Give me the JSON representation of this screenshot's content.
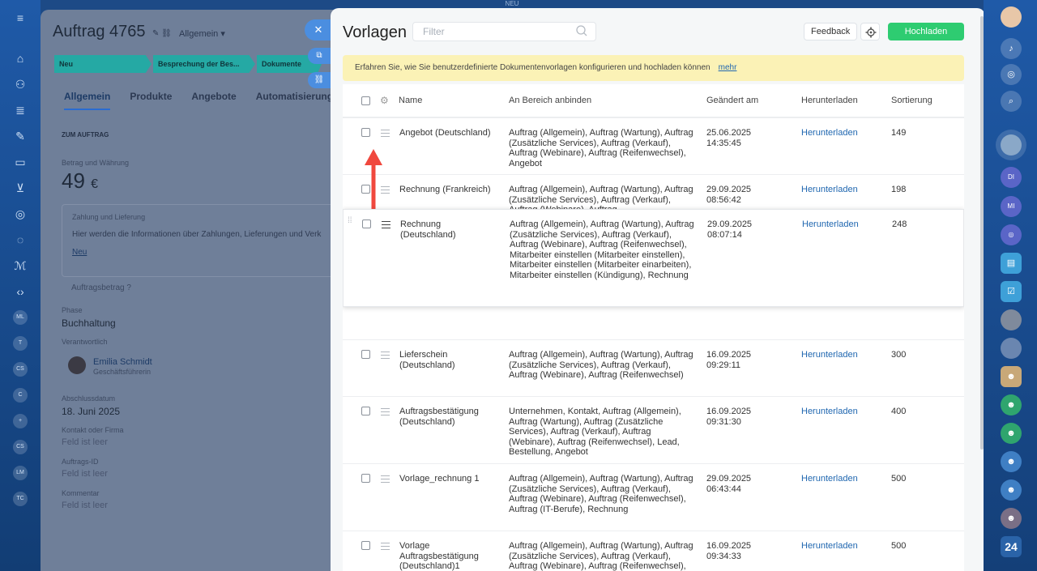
{
  "topbar": {
    "text": "NEU"
  },
  "order": {
    "title": "Auftrag 4765",
    "subtitle": "Allgemein",
    "stages": [
      "Neu",
      "Besprechung der Bes...",
      "Dokumente vorbereiten"
    ],
    "tabs": [
      "Allgemein",
      "Produkte",
      "Angebote",
      "Automatisierung"
    ],
    "section": "ZUM AUFTRAG",
    "amount_label": "Betrag und Währung",
    "amount": "49",
    "currency": "€",
    "payment_label": "Zahlung und Lieferung",
    "payment_text": "Hier werden die Informationen über Zahlungen, Lieferungen und Verk",
    "payment_link": "Neu",
    "order_amount": "Auftragsbetrag",
    "phase_label": "Phase",
    "phase_value": "Buchhaltung",
    "responsible_label": "Verantwortlich",
    "responsible_name": "Emilia Schmidt",
    "responsible_role": "Geschäftsführerin",
    "date_label": "Abschlussdatum",
    "date_value": "18. Juni 2025",
    "empty_fields": [
      {
        "label": "Kontakt oder Firma",
        "value": "Feld ist leer"
      },
      {
        "label": "Auftrags-ID",
        "value": "Feld ist leer"
      },
      {
        "label": "Kommentar",
        "value": "Feld ist leer"
      }
    ]
  },
  "templates": {
    "title": "Vorlagen",
    "filter_placeholder": "Filter",
    "feedback": "Feedback",
    "upload": "Hochladen",
    "info_text": "Erfahren Sie, wie Sie benutzerdefinierte Dokumentenvorlagen konfigurieren und hochladen können",
    "info_link": "mehr",
    "columns": [
      "Name",
      "An Bereich anbinden",
      "Geändert am",
      "Herunterladen",
      "Sortierung"
    ],
    "rows": [
      {
        "name": "Angebot (Deutschland)",
        "bind": "Auftrag (Allgemein), Auftrag (Wartung), Auftrag (Zusätzliche Services), Auftrag (Verkauf), Auftrag (Webinare), Auftrag (Reifenwechsel), Angebot",
        "date": "25.06.2025\n14:35:45",
        "download": "Herunterladen",
        "sort": "149"
      },
      {
        "name": "Rechnung (Frankreich)",
        "bind": "Auftrag (Allgemein), Auftrag (Wartung), Auftrag (Zusätzliche Services), Auftrag (Verkauf), Auftrag (Webinare), Auftrag",
        "date": "29.09.2025\n08:56:42",
        "download": "Herunterladen",
        "sort": "198"
      },
      {
        "name": "Rechnung (Deutschland)",
        "bind": "Auftrag (Allgemein), Auftrag (Wartung), Auftrag (Zusätzliche Services), Auftrag (Verkauf), Auftrag (Webinare), Auftrag (Reifenwechsel), Mitarbeiter einstellen (Mitarbeiter einstellen), Mitarbeiter einstellen (Mitarbeiter einarbeiten), Mitarbeiter einstellen (Kündigung), Rechnung",
        "date": "29.09.2025\n08:07:14",
        "download": "Herunterladen",
        "sort": "248"
      },
      {
        "name": "Lieferschein (Deutschland)",
        "bind": "Auftrag (Allgemein), Auftrag (Wartung), Auftrag (Zusätzliche Services), Auftrag (Verkauf), Auftrag (Webinare), Auftrag (Reifenwechsel)",
        "date": "16.09.2025\n09:29:11",
        "download": "Herunterladen",
        "sort": "300"
      },
      {
        "name": "Auftragsbestätigung (Deutschland)",
        "bind": "Unternehmen, Kontakt, Auftrag (Allgemein), Auftrag (Wartung), Auftrag (Zusätzliche Services), Auftrag (Verkauf), Auftrag (Webinare), Auftrag (Reifenwechsel), Lead, Bestellung, Angebot",
        "date": "16.09.2025\n09:31:30",
        "download": "Herunterladen",
        "sort": "400"
      },
      {
        "name": "Vorlage_rechnung 1",
        "bind": "Auftrag (Allgemein), Auftrag (Wartung), Auftrag (Zusätzliche Services), Auftrag (Verkauf), Auftrag (Webinare), Auftrag (Reifenwechsel), Auftrag (IT-Berufe), Rechnung",
        "date": "29.09.2025\n06:43:44",
        "download": "Herunterladen",
        "sort": "500"
      },
      {
        "name": "Vorlage Auftragsbestätigung (Deutschland)1",
        "bind": "Auftrag (Allgemein), Auftrag (Wartung), Auftrag (Zusätzliche Services), Auftrag (Verkauf), Auftrag (Webinare), Auftrag (Reifenwechsel), Auftrag (IT-Berufe)",
        "date": "16.09.2025\n09:34:33",
        "download": "Herunterladen",
        "sort": "500"
      }
    ]
  },
  "left_rail": {
    "labels": [
      "ML",
      "T",
      "CS",
      "C",
      "+",
      "CS",
      "LM",
      "TC"
    ]
  },
  "right_rail": {
    "avatars": [
      "DI",
      "MI"
    ],
    "counter": "24"
  },
  "colors": {
    "accent_green": "#2ecc71",
    "link_blue": "#2067b0",
    "info_yellow": "#fbf2b6",
    "drag_arrow_red": "#f0483e"
  }
}
